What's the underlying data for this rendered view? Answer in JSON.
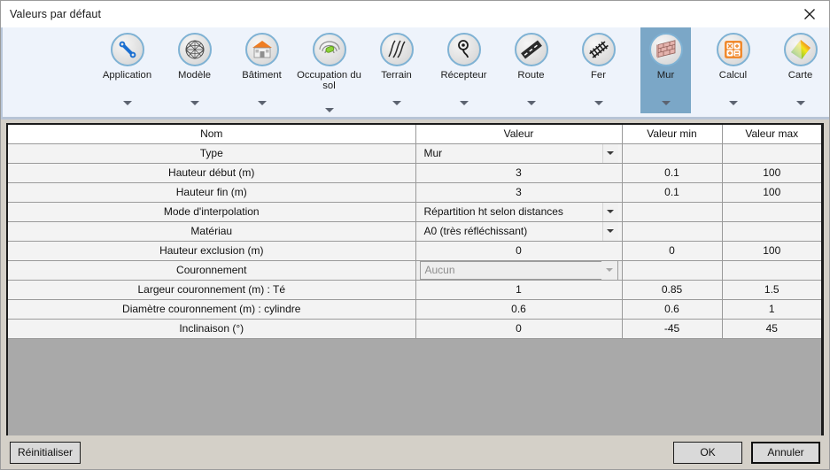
{
  "window": {
    "title": "Valeurs par défaut",
    "close_icon": "close-icon"
  },
  "ribbon": {
    "items": [
      {
        "label": "Application",
        "icon": "wrench-icon",
        "selected": false,
        "caret": true
      },
      {
        "label": "Modèle",
        "icon": "globe-mesh-icon",
        "selected": false,
        "caret": true
      },
      {
        "label": "Bâtiment",
        "icon": "building-icon",
        "selected": false,
        "caret": true
      },
      {
        "label": "Occupation du sol",
        "icon": "land-use-icon",
        "selected": false,
        "caret": true
      },
      {
        "label": "Terrain",
        "icon": "terrain-icon",
        "selected": false,
        "caret": true
      },
      {
        "label": "Récepteur",
        "icon": "receiver-icon",
        "selected": false,
        "caret": true
      },
      {
        "label": "Route",
        "icon": "road-icon",
        "selected": false,
        "caret": true
      },
      {
        "label": "Fer",
        "icon": "railway-icon",
        "selected": false,
        "caret": true
      },
      {
        "label": "Mur",
        "icon": "wall-icon",
        "selected": true,
        "caret": true
      },
      {
        "label": "Calcul",
        "icon": "calculator-icon",
        "selected": false,
        "caret": true
      },
      {
        "label": "Carte",
        "icon": "colormap-icon",
        "selected": false,
        "caret": true
      }
    ]
  },
  "table": {
    "headers": [
      "Nom",
      "Valeur",
      "Valeur min",
      "Valeur max"
    ],
    "rows": [
      {
        "name": "Type",
        "value": "Mur",
        "type": "combo",
        "disabled": false,
        "min": "",
        "max": ""
      },
      {
        "name": "Hauteur début (m)",
        "value": "3",
        "type": "text",
        "disabled": false,
        "min": "0.1",
        "max": "100"
      },
      {
        "name": "Hauteur fin (m)",
        "value": "3",
        "type": "text",
        "disabled": false,
        "min": "0.1",
        "max": "100"
      },
      {
        "name": "Mode d'interpolation",
        "value": "Répartition ht selon distances",
        "type": "combo",
        "disabled": false,
        "min": "",
        "max": ""
      },
      {
        "name": "Matériau",
        "value": "A0 (très réfléchissant)",
        "type": "combo",
        "disabled": false,
        "min": "",
        "max": ""
      },
      {
        "name": "Hauteur exclusion (m)",
        "value": "0",
        "type": "text",
        "disabled": false,
        "min": "0",
        "max": "100"
      },
      {
        "name": "Couronnement",
        "value": "Aucun",
        "type": "combo",
        "disabled": true,
        "min": "",
        "max": ""
      },
      {
        "name": "Largeur couronnement (m) : Té",
        "value": "1",
        "type": "text",
        "disabled": false,
        "min": "0.85",
        "max": "1.5"
      },
      {
        "name": "Diamètre couronnement (m) : cylindre",
        "value": "0.6",
        "type": "text",
        "disabled": false,
        "min": "0.6",
        "max": "1"
      },
      {
        "name": "Inclinaison (°)",
        "value": "0",
        "type": "text",
        "disabled": false,
        "min": "-45",
        "max": "45"
      }
    ]
  },
  "footer": {
    "reset_label": "Réinitialiser",
    "ok_label": "OK",
    "cancel_label": "Annuler"
  },
  "colors": {
    "ribbon_background": "#eef3fb",
    "ribbon_selected": "#7ba7c7",
    "name_text": "#118811",
    "row_background": "#f3f3f3",
    "empty_area": "#a9a9a9",
    "dialog_background": "#d4d0c8"
  }
}
